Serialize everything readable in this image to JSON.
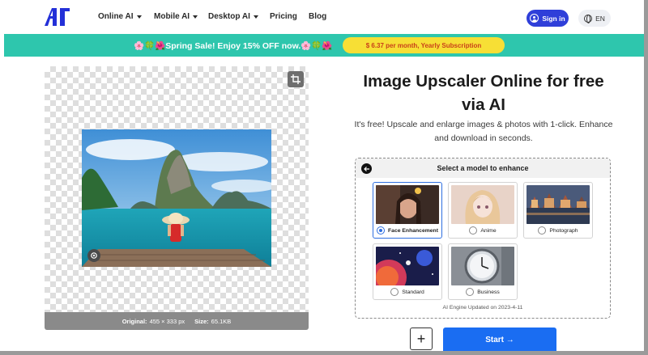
{
  "nav": {
    "logo_text": "AI",
    "items": [
      {
        "label": "Online AI",
        "dropdown": true
      },
      {
        "label": "Mobile AI",
        "dropdown": true
      },
      {
        "label": "Desktop AI",
        "dropdown": true
      },
      {
        "label": "Pricing",
        "dropdown": false
      },
      {
        "label": "Blog",
        "dropdown": false
      }
    ],
    "signin_label": "Sign in",
    "lang_label": "EN"
  },
  "banner": {
    "text": "🌸🍀🌺Spring Sale! Enjoy 15% OFF now.🌸🍀🌺",
    "cta_label": "$ 6.37 per month, Yearly Subscription"
  },
  "preview": {
    "original_label": "Original:",
    "original_value": "455 × 333 px",
    "size_label": "Size:",
    "size_value": "65.1KB"
  },
  "main": {
    "title": "Image Upscaler Online for free via AI",
    "subtitle": "It's free! Upscale and enlarge images & photos with 1-click. Enhance and download in seconds."
  },
  "models": {
    "heading": "Select a model to enhance",
    "options": [
      {
        "label": "Face Enhancement",
        "selected": true
      },
      {
        "label": "Anime",
        "selected": false
      },
      {
        "label": "Photograph",
        "selected": false
      },
      {
        "label": "Standard",
        "selected": false
      },
      {
        "label": "Business",
        "selected": false
      }
    ],
    "engine_note": "AI Engine Updated on 2023-4-11"
  },
  "actions": {
    "add_label": "+",
    "start_label": "Start →"
  },
  "colors": {
    "accent": "#2f3fd9",
    "banner": "#2ec6ad",
    "banner_cta": "#f7df35",
    "start": "#1a6df2"
  }
}
